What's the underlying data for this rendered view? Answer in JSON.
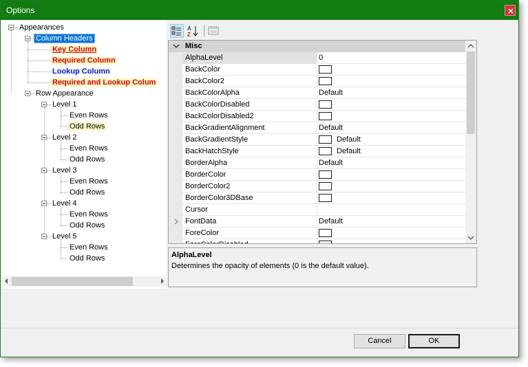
{
  "window": {
    "title": "Options",
    "close_label": "×"
  },
  "tree": {
    "appearances": "Appearances",
    "column_headers": "Column Headers",
    "key_column": "Key Column",
    "required_column": "Required Column",
    "lookup_column": "Lookup Column",
    "required_lookup_column": "Required and Lookup Colum",
    "row_appearance": "Row Appearance",
    "levels": [
      {
        "label": "Level 1",
        "even": "Even Rows",
        "odd": "Odd Rows"
      },
      {
        "label": "Level 2",
        "even": "Even Rows",
        "odd": "Odd Rows"
      },
      {
        "label": "Level 3",
        "even": "Even Rows",
        "odd": "Odd Rows"
      },
      {
        "label": "Level 4",
        "even": "Even Rows",
        "odd": "Odd Rows"
      },
      {
        "label": "Level 5",
        "even": "Even Rows",
        "odd": "Odd Rows"
      }
    ]
  },
  "grid": {
    "category": "Misc",
    "rows": [
      {
        "name": "AlphaLevel",
        "value": "0",
        "swatch": false
      },
      {
        "name": "BackColor",
        "value": "",
        "swatch": true
      },
      {
        "name": "BackColor2",
        "value": "",
        "swatch": true
      },
      {
        "name": "BackColorAlpha",
        "value": "Default",
        "swatch": false
      },
      {
        "name": "BackColorDisabled",
        "value": "",
        "swatch": true
      },
      {
        "name": "BackColorDisabled2",
        "value": "",
        "swatch": true
      },
      {
        "name": "BackGradientAlignment",
        "value": "Default",
        "swatch": false
      },
      {
        "name": "BackGradientStyle",
        "value": "Default",
        "swatch": true
      },
      {
        "name": "BackHatchStyle",
        "value": "Default",
        "swatch": true
      },
      {
        "name": "BorderAlpha",
        "value": "Default",
        "swatch": false
      },
      {
        "name": "BorderColor",
        "value": "",
        "swatch": true
      },
      {
        "name": "BorderColor2",
        "value": "",
        "swatch": true
      },
      {
        "name": "BorderColor3DBase",
        "value": "",
        "swatch": true
      },
      {
        "name": "Cursor",
        "value": "",
        "swatch": false
      },
      {
        "name": "FontData",
        "value": "Default",
        "swatch": false
      },
      {
        "name": "ForeColor",
        "value": "",
        "swatch": true
      },
      {
        "name": "ForeColorDisabled",
        "value": "",
        "swatch": true
      }
    ]
  },
  "description": {
    "title": "AlphaLevel",
    "text": "Determines the opacity of elements (0 is the default value)."
  },
  "buttons": {
    "cancel": "Cancel",
    "ok": "OK"
  },
  "colors": {
    "titlebar": "#127c12",
    "selection": "#0a74d8",
    "red_label": "#d60000",
    "blue_label": "#0018c8"
  }
}
